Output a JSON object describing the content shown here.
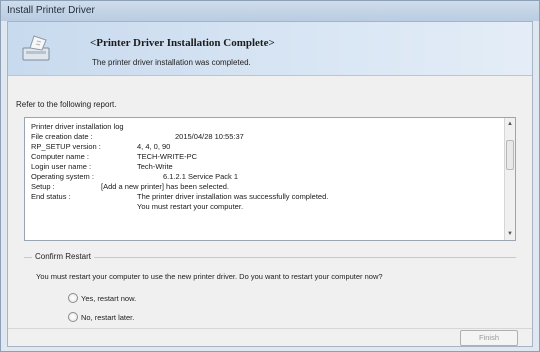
{
  "window": {
    "title": "Install Printer Driver"
  },
  "banner": {
    "title": "<Printer Driver Installation Complete>",
    "subtitle": "The printer driver installation was completed.",
    "icon": "installer-icon"
  },
  "refer_text": "Refer to the following report.",
  "log": {
    "lines": [
      {
        "label": "Printer driver installation log",
        "value": ""
      },
      {
        "label": "File creation date :",
        "value": "2015/04/28 10:55:37"
      },
      {
        "label": "RP_SETUP version :",
        "value": "4, 4, 0, 90"
      },
      {
        "label": "Computer name :",
        "value": "TECH-WRITE-PC"
      },
      {
        "label": "Login user name :",
        "value": "Tech-Write"
      },
      {
        "label": "Operating system :",
        "value": "6.1.2.1 Service Pack 1"
      },
      {
        "label": "Setup :",
        "value": "[Add a new printer] has been selected."
      },
      {
        "label": "End status :",
        "value": "The printer driver installation was successfully completed."
      },
      {
        "label": "",
        "value": "You must restart your computer."
      }
    ]
  },
  "confirm": {
    "legend": "Confirm Restart",
    "message": "You must restart your computer to use the new printer driver. Do you want to restart your computer now?",
    "options": [
      {
        "label": "Yes, restart now.",
        "selected": false
      },
      {
        "label": "No, restart later.",
        "selected": false
      }
    ]
  },
  "footer": {
    "finish_label": "Finish",
    "finish_enabled": false
  }
}
